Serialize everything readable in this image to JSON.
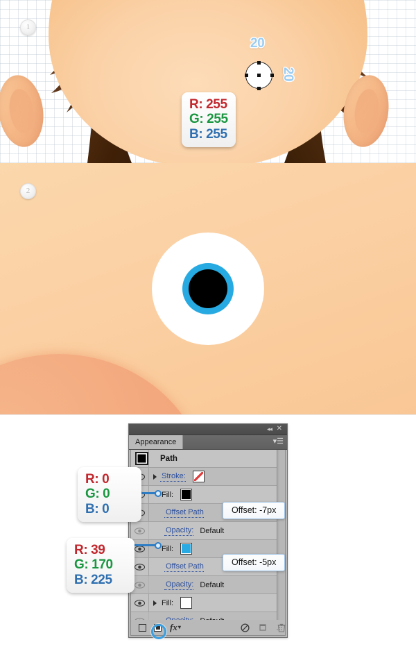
{
  "steps": {
    "badge_one": "1",
    "badge_two": "2"
  },
  "canvas_top": {
    "dimension_top": "20",
    "dimension_side": "20",
    "color_callout": {
      "r": "R: 255",
      "g": "G: 255",
      "b": "B: 255"
    },
    "shape_name": "selected-ellipse-with-anchor-points"
  },
  "canvas_mid": {
    "eye_white_color": "#ffffff",
    "iris_color": "#27aae1",
    "pupil_color": "#000000",
    "skin_color": "#fbd2a3"
  },
  "callouts": {
    "fill_black": {
      "r": "R: 0",
      "g": "G: 0",
      "b": "B: 0"
    },
    "fill_blue": {
      "r": "R: 39",
      "g": "G: 170",
      "b": "B: 225"
    }
  },
  "panel": {
    "title": "Appearance",
    "collapse_icon": "◂◂",
    "close_icon": "✕",
    "menu_icon": "▾☰",
    "target_label": "Path",
    "rows": [
      {
        "id": "stroke",
        "label": "Stroke:",
        "value": "",
        "swatch": "none",
        "eye": "on",
        "triangle": true,
        "indent": 0,
        "link": true
      },
      {
        "id": "fill-1",
        "label": "Fill:",
        "value": "",
        "swatch": "black",
        "eye": "on",
        "triangle": false,
        "indent": 0,
        "link": false
      },
      {
        "id": "offset-1",
        "label": "Offset Path",
        "value": "",
        "swatch": "",
        "eye": "on",
        "triangle": false,
        "indent": 1,
        "link": true
      },
      {
        "id": "opacity-1",
        "label": "Opacity:",
        "value": "Default",
        "swatch": "",
        "eye": "off",
        "triangle": false,
        "indent": 1,
        "link": true
      },
      {
        "id": "fill-2",
        "label": "Fill:",
        "value": "",
        "swatch": "blue",
        "eye": "on",
        "triangle": false,
        "indent": 0,
        "link": false
      },
      {
        "id": "offset-2",
        "label": "Offset Path",
        "value": "",
        "swatch": "",
        "eye": "on",
        "triangle": false,
        "indent": 1,
        "link": true
      },
      {
        "id": "opacity-2",
        "label": "Opacity:",
        "value": "Default",
        "swatch": "",
        "eye": "off",
        "triangle": false,
        "indent": 1,
        "link": true
      },
      {
        "id": "fill-3",
        "label": "Fill:",
        "value": "",
        "swatch": "white",
        "eye": "on",
        "triangle": true,
        "indent": 0,
        "link": false
      },
      {
        "id": "opacity-3",
        "label": "Opacity:",
        "value": "Default",
        "swatch": "",
        "eye": "off",
        "triangle": false,
        "indent": 1,
        "link": true
      }
    ],
    "labels": {
      "stroke": "Stroke:",
      "fill": "Fill:",
      "offset_path": "Offset Path",
      "opacity": "Opacity:",
      "default": "Default"
    },
    "tooltips": {
      "offset_7": "Offset: -7px",
      "offset_5": "Offset: -5px"
    },
    "footer": {
      "new_art_icon": "new-art-has-basic-appearance",
      "clear_icon": "clear-appearance",
      "fx_label": "fx",
      "fx_caret": "▾",
      "no_style_icon": "⊘",
      "duplicate_icon": "duplicate-item",
      "delete_icon": "delete-item",
      "grip_icon": "resize-grip"
    }
  },
  "colors": {
    "accent_blue": "#27aae1",
    "panel_gray": "#c0c0c0",
    "link_blue": "#2b4f9e",
    "callout_red": "#c1272d",
    "callout_green": "#1a9641",
    "callout_blue": "#2f6fb0",
    "highlight_ring": "#3b9fe0"
  }
}
